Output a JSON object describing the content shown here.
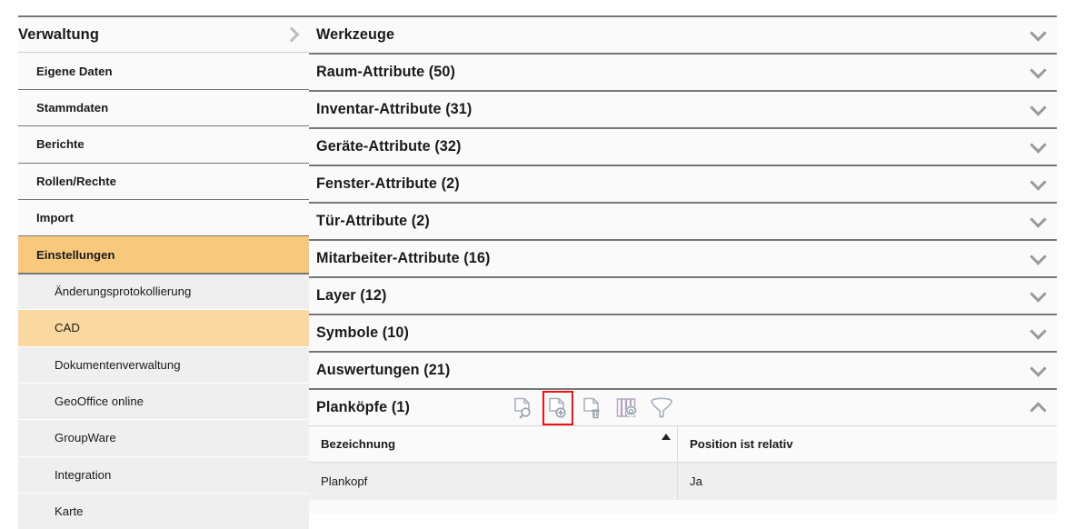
{
  "sidebar": {
    "root": {
      "label": "Verwaltung",
      "chevron_icon": "chevron-right-icon"
    },
    "items": [
      {
        "label": "Eigene Daten",
        "selected": false
      },
      {
        "label": "Stammdaten",
        "selected": false
      },
      {
        "label": "Berichte",
        "selected": false
      },
      {
        "label": "Rollen/Rechte",
        "selected": false
      },
      {
        "label": "Import",
        "selected": false
      },
      {
        "label": "Einstellungen",
        "selected": true
      }
    ],
    "subitems": [
      {
        "label": "Änderungsprotokollierung",
        "selected": false
      },
      {
        "label": "CAD",
        "selected": true
      },
      {
        "label": "Dokumentenverwaltung",
        "selected": false
      },
      {
        "label": "GeoOffice online",
        "selected": false
      },
      {
        "label": "GroupWare",
        "selected": false
      },
      {
        "label": "Integration",
        "selected": false
      },
      {
        "label": "Karte",
        "selected": false
      }
    ]
  },
  "main": {
    "sections": [
      {
        "title": "Werkzeuge",
        "expanded": false
      },
      {
        "title": "Raum-Attribute (50)",
        "expanded": false
      },
      {
        "title": "Inventar-Attribute (31)",
        "expanded": false
      },
      {
        "title": "Geräte-Attribute (32)",
        "expanded": false
      },
      {
        "title": "Fenster-Attribute (2)",
        "expanded": false
      },
      {
        "title": "Tür-Attribute (2)",
        "expanded": false
      },
      {
        "title": "Mitarbeiter-Attribute (16)",
        "expanded": false
      },
      {
        "title": "Layer (12)",
        "expanded": false
      },
      {
        "title": "Symbole (10)",
        "expanded": false
      },
      {
        "title": "Auswertungen (21)",
        "expanded": false
      }
    ],
    "expanded_section": {
      "title": "Planköpfe (1)",
      "chevron_icon": "chevron-up-icon",
      "toolbar": [
        {
          "name": "document-search-icon",
          "label": "Anzeigen",
          "highlighted": false
        },
        {
          "name": "document-add-icon",
          "label": "Neu",
          "highlighted": true
        },
        {
          "name": "document-delete-icon",
          "label": "Löschen",
          "highlighted": false
        },
        {
          "name": "columns-settings-icon",
          "label": "Spalten",
          "highlighted": false
        },
        {
          "name": "filter-funnel-icon",
          "label": "Filter",
          "highlighted": false
        }
      ],
      "table": {
        "columns": [
          {
            "label": "Bezeichnung",
            "sorted": true,
            "sort_direction": "asc"
          },
          {
            "label": "Position ist relativ",
            "sorted": false
          }
        ],
        "rows": [
          {
            "bezeichnung": "Plankopf",
            "position_ist_relativ": "Ja"
          }
        ]
      }
    }
  },
  "colors": {
    "highlight_orange": "#f8c97c",
    "subitem_orange": "#fbd89f",
    "selection_red": "#ee1111",
    "border_grey": "#777777",
    "row_grey": "#efefef",
    "icon_grey": "#9aa4b0"
  }
}
